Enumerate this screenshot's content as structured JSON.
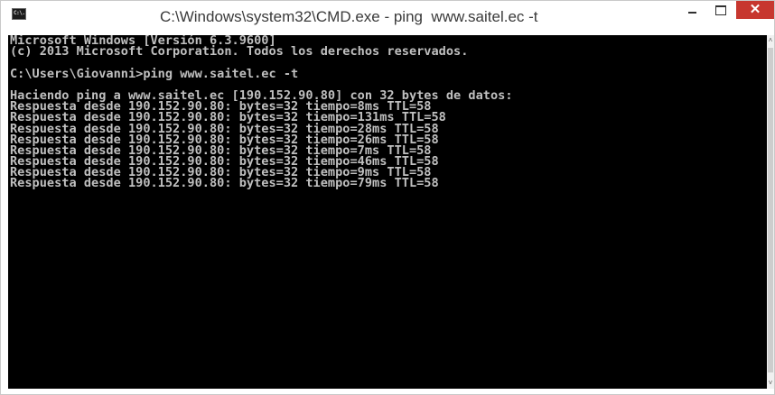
{
  "window": {
    "title": "C:\\Windows\\system32\\CMD.exe - ping  www.saitel.ec -t",
    "icon": "cmd-icon",
    "icon_text": "C:\\.",
    "controls": {
      "minimize": "minimize-icon",
      "maximize": "maximize-icon",
      "close": "✕"
    }
  },
  "console": {
    "lines": [
      "Microsoft Windows [Versión 6.3.9600]",
      "(c) 2013 Microsoft Corporation. Todos los derechos reservados.",
      "",
      "C:\\Users\\Giovanni>ping www.saitel.ec -t",
      "",
      "Haciendo ping a www.saitel.ec [190.152.90.80] con 32 bytes de datos:",
      "Respuesta desde 190.152.90.80: bytes=32 tiempo=8ms TTL=58",
      "Respuesta desde 190.152.90.80: bytes=32 tiempo=131ms TTL=58",
      "Respuesta desde 190.152.90.80: bytes=32 tiempo=28ms TTL=58",
      "Respuesta desde 190.152.90.80: bytes=32 tiempo=26ms TTL=58",
      "Respuesta desde 190.152.90.80: bytes=32 tiempo=7ms TTL=58",
      "Respuesta desde 190.152.90.80: bytes=32 tiempo=46ms TTL=58",
      "Respuesta desde 190.152.90.80: bytes=32 tiempo=9ms TTL=58",
      "Respuesta desde 190.152.90.80: bytes=32 tiempo=79ms TTL=58"
    ]
  },
  "scrollbar": {
    "up_arrow": "˄",
    "down_arrow": "˅"
  },
  "colors": {
    "console_bg": "#000000",
    "console_fg": "#c0c0c0",
    "close_button": "#c7372f"
  }
}
